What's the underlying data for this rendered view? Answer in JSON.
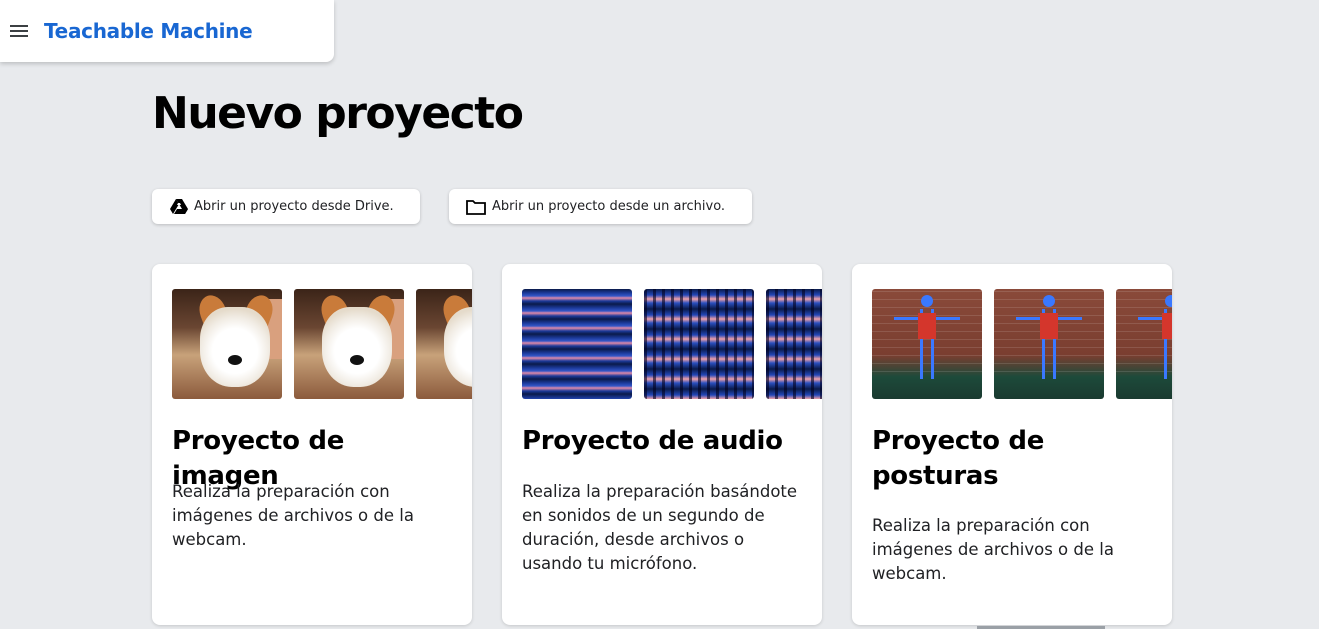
{
  "header": {
    "brand": "Teachable Machine",
    "menu_icon": "hamburger-menu-icon"
  },
  "page": {
    "title": "Nuevo proyecto"
  },
  "actions": {
    "drive_label": "Abrir un proyecto desde Drive.",
    "drive_icon": "google-drive-icon",
    "file_label": "Abrir un proyecto desde un archivo.",
    "file_icon": "folder-icon"
  },
  "cards": [
    {
      "title": "Proyecto de imagen",
      "description": "Realiza la preparación con imágenes de archivos o de la webcam."
    },
    {
      "title": "Proyecto de audio",
      "description": "Realiza la preparación basándote en sonidos de un segundo de duración, desde archivos o usando tu micrófono."
    },
    {
      "title": "Proyecto de posturas",
      "description": "Realiza la preparación con imágenes de archivos o de la webcam."
    }
  ],
  "colors": {
    "brand": "#1967d2",
    "background": "#e8eaed"
  }
}
